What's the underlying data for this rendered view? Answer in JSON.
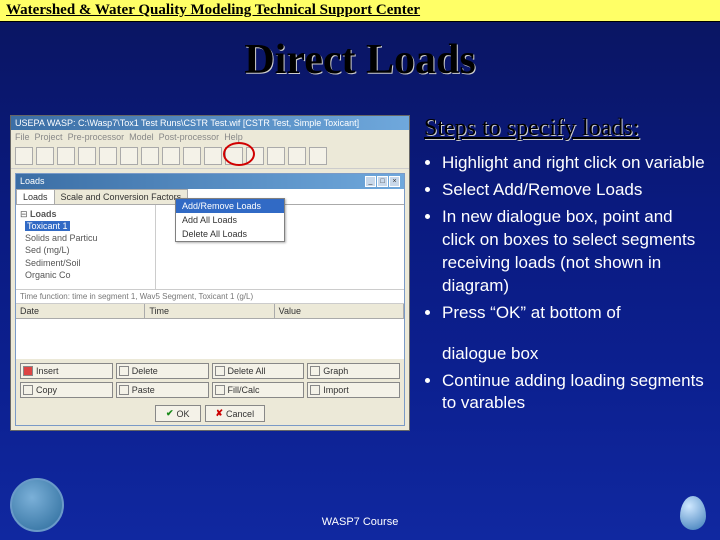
{
  "header": {
    "title": "Watershed & Water Quality Modeling Technical Support Center"
  },
  "slide": {
    "title": "Direct Loads"
  },
  "app": {
    "window_title": "USEPA WASP: C:\\Wasp7\\Tox1 Test Runs\\CSTR Test.wif [CSTR Test, Simple Toxicant]",
    "menus": [
      "File",
      "Project",
      "Pre-processor",
      "Model",
      "Post-processor",
      "Help"
    ],
    "toolbar_icons": [
      "new",
      "open",
      "save",
      "sep",
      "seg",
      "disp",
      "flow",
      "bound",
      "load",
      "tk",
      "print",
      "const",
      "sep",
      "run",
      "graph",
      "table"
    ],
    "loads_window": {
      "title": "Loads",
      "tabs": [
        "Loads",
        "Scale and Conversion Factors"
      ],
      "tree": {
        "root": "Loads",
        "selected": "Toxicant 1",
        "children": [
          "Solids and Particu",
          "Sed (mg/L)",
          "Sediment/Soil",
          "Organic Co"
        ]
      },
      "context_menu": [
        "Add/Remove Loads",
        "Add All Loads",
        "Delete All Loads"
      ],
      "grid_hint": "Time function: time in segment 1, Wav5 Segment, Toxicant 1 (g/L)",
      "columns": [
        "Date",
        "Time",
        "Value"
      ],
      "buttons": [
        "Insert",
        "Delete",
        "Delete All",
        "Graph",
        "Copy",
        "Paste",
        "Fill/Calc",
        "Import"
      ],
      "ok": "OK",
      "cancel": "Cancel"
    }
  },
  "steps": {
    "title": "Steps to specify loads:",
    "items": [
      "Highlight and right click on variable",
      "Select Add/Remove Loads",
      "In new dialogue box, point and click on boxes to select segments receiving loads (not shown in diagram)",
      "Press “OK” at bottom of",
      "dialogue box",
      "Continue adding loading segments to varables"
    ]
  },
  "footer": {
    "course": "WASP7 Course"
  }
}
